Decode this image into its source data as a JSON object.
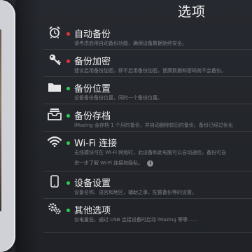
{
  "panel": {
    "title": "选项"
  },
  "items": [
    {
      "label": "自动备份",
      "desc": "请考虑启用自动备份功能，确保设备数据始终安全。",
      "status": "red",
      "icon": "alarm-clock-icon"
    },
    {
      "label": "备份加密",
      "desc": "建议启用备份加密，即不启用备份加密，健康数据和密码就不会备份。",
      "status": "red",
      "icon": "key-icon"
    },
    {
      "label": "备份位置",
      "desc": "设备备份备份位置，同时一个备份位置。",
      "status": "green",
      "icon": "folder-icon"
    },
    {
      "label": "备份存档",
      "desc": "iMazing 会存档 1 个月的备份，并自动删除较旧的备份。备份已经过优化",
      "status": "green",
      "icon": "archive-tray-icon"
    },
    {
      "label": "Wi-Fi 连接",
      "desc": "无线模块可在 Wi-Fi 网络时，此设备和此电脑可以自动通信。备份可自",
      "desc2": "进一步了解 Wi-Fi 连接和隐私。",
      "status": "green",
      "icon": "wifi-icon"
    },
    {
      "label": "设备设置",
      "desc": "设备名称、语言和地区，辅助之事，配置备份等的设置。",
      "status": "green",
      "icon": "phone-icon"
    },
    {
      "label": "其他选项",
      "desc": "仅电量低，通过 USB 连接设备时启动 iMazing 等等……",
      "status": "green",
      "icon": "gears-icon"
    }
  ]
}
